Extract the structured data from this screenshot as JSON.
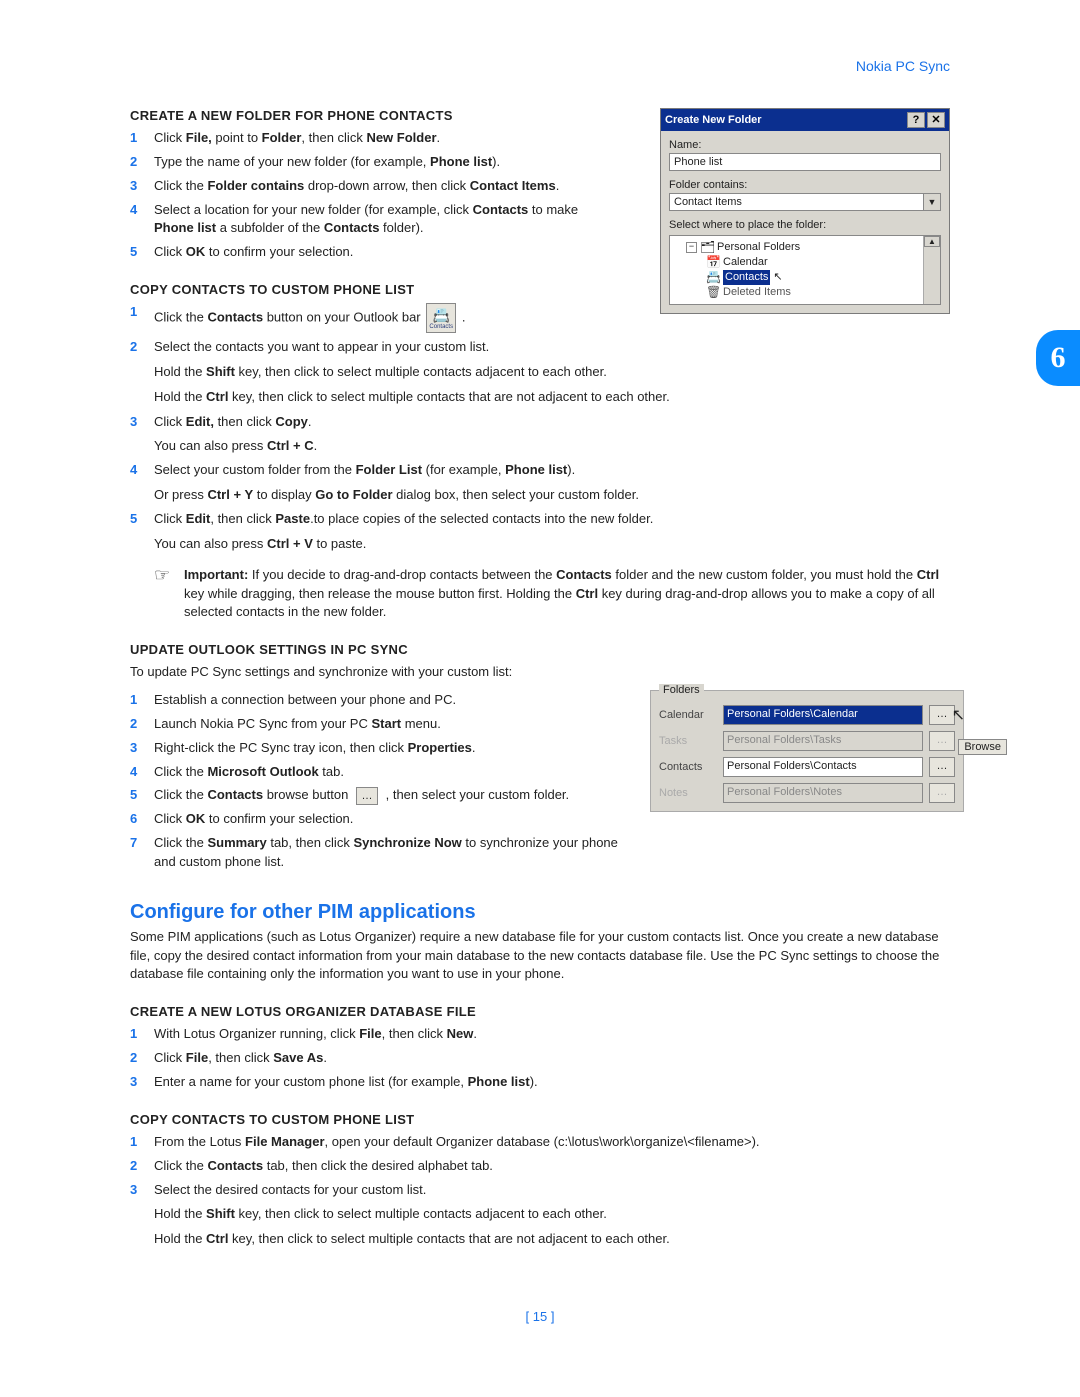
{
  "header_right": "Nokia PC Sync",
  "chapter_number": "6",
  "page_number": "[ 15 ]",
  "section1": {
    "title": "CREATE A NEW FOLDER FOR PHONE CONTACTS",
    "steps": [
      {
        "n": "1",
        "html": "Click <b>File,</b> point to <b>Folder</b>, then click <b>New Folder</b>."
      },
      {
        "n": "2",
        "html": "Type the name of your new folder (for example, <b>Phone list</b>)."
      },
      {
        "n": "3",
        "html": "Click the <b>Folder contains</b> drop-down arrow, then click <b>Contact Items</b>."
      },
      {
        "n": "4",
        "html": "Select a location for your new folder (for example, click <b>Contacts</b> to make <b>Phone list</b> a subfolder of the <b>Contacts</b> folder)."
      },
      {
        "n": "5",
        "html": "Click <b>OK</b> to confirm your selection."
      }
    ]
  },
  "section2": {
    "title": "COPY CONTACTS TO CUSTOM PHONE LIST",
    "step1_pre": "Click the ",
    "step1_bold": "Contacts",
    "step1_post": " button on your Outlook bar ",
    "icon_label": "Contacts",
    "steps_rest": [
      {
        "n": "2",
        "html": "Select the contacts you want to appear in your custom list."
      }
    ],
    "shift_line": "Hold the <b>Shift</b> key, then click to select multiple contacts adjacent to each other.",
    "ctrl_line": "Hold the <b>Ctrl</b> key, then click to select multiple contacts that are not adjacent to each other.",
    "steps_after": [
      {
        "n": "3",
        "html": "Click <b>Edit,</b> then click <b>Copy</b>.",
        "sub": "You can also press <b>Ctrl + C</b>."
      },
      {
        "n": "4",
        "html": "Select your custom folder from the <b>Folder List</b> (for example, <b>Phone list</b>).",
        "sub": "Or press <b>Ctrl + Y</b> to display <b>Go to Folder</b> dialog box, then select your custom folder."
      },
      {
        "n": "5",
        "html": "Click <b>Edit</b>, then click <b>Paste</b>.to place copies of the selected contacts into the new folder.",
        "sub": "You can also press <b>Ctrl + V</b> to paste."
      }
    ],
    "important": "<b>Important:</b> If you decide to drag-and-drop contacts between the <b>Contacts</b> folder and the new custom folder, you must hold the <b>Ctrl</b> key while dragging, then release the mouse button first. Holding the <b>Ctrl</b> key during drag-and-drop allows you to make a copy of all selected contacts in the new folder."
  },
  "section3": {
    "title": "UPDATE OUTLOOK SETTINGS IN PC SYNC",
    "intro": "To update PC Sync settings and synchronize with your custom list:",
    "steps_a": [
      {
        "n": "1",
        "html": "Establish a connection between your phone and PC."
      },
      {
        "n": "2",
        "html": "Launch Nokia PC Sync from your PC <b>Start</b> menu."
      },
      {
        "n": "3",
        "html": "Right-click the PC Sync tray icon, then click <b>Properties</b>."
      },
      {
        "n": "4",
        "html": "Click the <b>Microsoft Outlook</b> tab."
      }
    ],
    "step5_pre": "Click the ",
    "step5_b1": "Contacts",
    "step5_mid": " browse button ",
    "step5_post": ", then select your custom folder.",
    "steps_b": [
      {
        "n": "6",
        "html": "Click <b>OK</b> to confirm your selection."
      },
      {
        "n": "7",
        "html": "Click the <b>Summary</b> tab, then click <b>Synchronize Now</b> to synchronize your phone and custom phone list."
      }
    ]
  },
  "h2": "Configure for other PIM applications",
  "pim_intro": "Some PIM applications (such as Lotus Organizer) require a new database file for your custom contacts list. Once you create a new database file, copy the desired contact information from your main database to the new contacts database file. Use the PC Sync settings to choose the database file containing only the information you want to use in your phone.",
  "section4": {
    "title": "CREATE A NEW LOTUS ORGANIZER DATABASE FILE",
    "steps": [
      {
        "n": "1",
        "html": "With Lotus Organizer running, click <b>File</b>, then click <b>New</b>."
      },
      {
        "n": "2",
        "html": "Click <b>File</b>, then click <b>Save As</b>."
      },
      {
        "n": "3",
        "html": "Enter a name for your custom phone list (for example, <b>Phone list</b>)."
      }
    ]
  },
  "section5": {
    "title": "COPY CONTACTS TO CUSTOM PHONE LIST",
    "steps": [
      {
        "n": "1",
        "html": "From the Lotus <b>File Manager</b>, open your default Organizer database (c:\\lotus\\work\\organize\\&lt;filename&gt;)."
      },
      {
        "n": "2",
        "html": "Click the <b>Contacts</b> tab, then click the desired alphabet tab."
      },
      {
        "n": "3",
        "html": "Select the desired contacts for your custom list."
      }
    ],
    "shift_line": "Hold the <b>Shift</b> key, then click to select multiple contacts adjacent to each other.",
    "ctrl_line": "Hold the <b>Ctrl</b> key, then click to select multiple contacts that are not adjacent to each other."
  },
  "dialog": {
    "title": "Create New Folder",
    "name_label": "Name:",
    "name_value": "Phone list",
    "contains_label": "Folder contains:",
    "contains_value": "Contact Items",
    "place_label": "Select where to place the folder:",
    "tree": {
      "root": "Personal Folders",
      "items": [
        "Calendar",
        "Contacts",
        "Deleted Items"
      ],
      "selected": "Contacts"
    }
  },
  "folders": {
    "legend": "Folders",
    "rows": [
      {
        "label": "Calendar",
        "value": "Personal Folders\\Calendar",
        "highlight": true,
        "disabled": false
      },
      {
        "label": "Tasks",
        "value": "Personal Folders\\Tasks",
        "disabled": true
      },
      {
        "label": "Contacts",
        "value": "Personal Folders\\Contacts",
        "disabled": false
      },
      {
        "label": "Notes",
        "value": "Personal Folders\\Notes",
        "disabled": true
      }
    ],
    "browse_label": "Browse"
  }
}
